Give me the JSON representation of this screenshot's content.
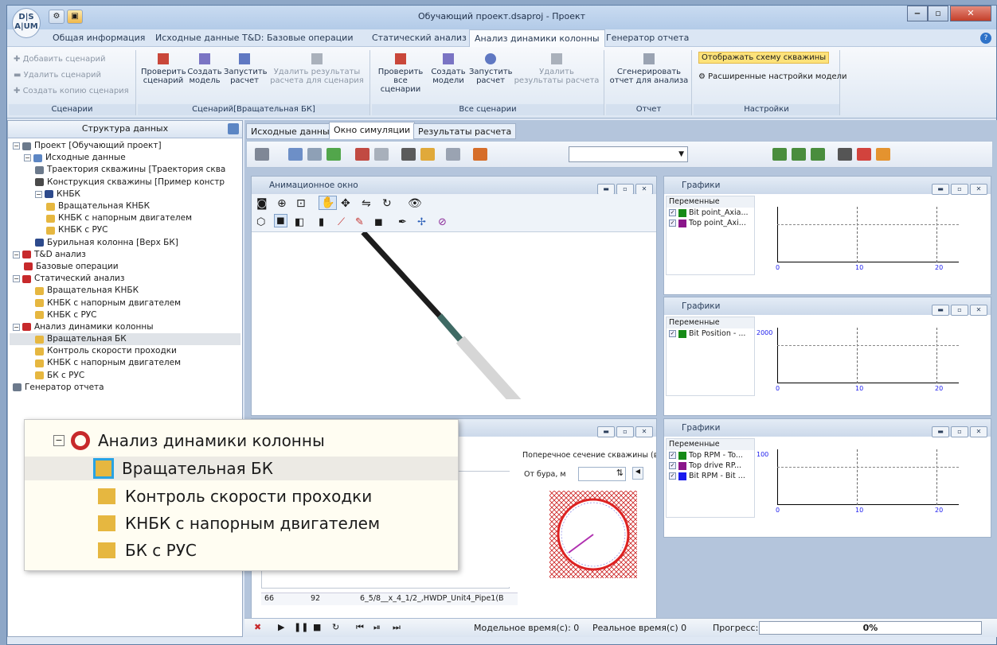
{
  "window": {
    "title": "Обучающий проект.dsaproj - Проект",
    "app_logo": "DS AUM"
  },
  "menu": [
    "Общая информация",
    "Исходные данные",
    "T&D: Базовые операции",
    "Статический анализ",
    "Анализ динамики колонны",
    "Генератор отчета"
  ],
  "ribbon": {
    "scen": {
      "add": "Добавить сценарий",
      "del": "Удалить сценарий",
      "copy": "Создать копию сценария",
      "title": "Сценарии"
    },
    "rot": {
      "check": "Проверить сценарий",
      "create": "Создать модель",
      "run": "Запустить расчет",
      "delres": "Удалить результаты расчета для сценария",
      "title": "Сценарий[Вращательная БК]"
    },
    "all": {
      "check": "Проверить все сценарии",
      "create": "Создать модели",
      "run": "Запустить расчет",
      "delres": "Удалить результаты расчета",
      "title": "Все сценарии"
    },
    "report": {
      "gen": "Сгенерировать отчет для анализа",
      "title": "Отчет"
    },
    "settings": {
      "scheme": "Отображать схему скважины",
      "adv": "Расширенные настройки модели",
      "title": "Настройки"
    }
  },
  "left": {
    "title": "Структура данных",
    "tree": [
      {
        "t": "Проект [Обучающий проект]",
        "lvl": 0,
        "exp": "−",
        "c": "#6c7a8c"
      },
      {
        "t": "Исходные данные",
        "lvl": 1,
        "exp": "−",
        "c": "#5c86c4"
      },
      {
        "t": "Траектория скважины [Траектория сква",
        "lvl": 2,
        "c": "#6c7a8c"
      },
      {
        "t": "Конструкция скважины [Пример констр",
        "lvl": 2,
        "c": "#4a4a4a"
      },
      {
        "t": "КНБК",
        "lvl": 2,
        "exp": "−",
        "c": "#2d4a8c"
      },
      {
        "t": "Вращательная КНБК",
        "lvl": 3,
        "c": "#e6b740"
      },
      {
        "t": "КНБК с напорным двигателем",
        "lvl": 3,
        "c": "#e6b740"
      },
      {
        "t": "КНБК с РУС",
        "lvl": 3,
        "c": "#e6b740"
      },
      {
        "t": "Бурильная колонна [Верх БК]",
        "lvl": 2,
        "c": "#2d4a8c"
      },
      {
        "t": "T&D анализ",
        "lvl": 0,
        "exp": "−",
        "c": "#c7292b"
      },
      {
        "t": "Базовые операции",
        "lvl": 1,
        "c": "#c7292b"
      },
      {
        "t": "Статический анализ",
        "lvl": 0,
        "exp": "−",
        "c": "#c7292b"
      },
      {
        "t": "Вращательная КНБК",
        "lvl": 2,
        "c": "#e6b740"
      },
      {
        "t": "КНБК с напорным двигателем",
        "lvl": 2,
        "c": "#e6b740"
      },
      {
        "t": "КНБК с РУС",
        "lvl": 2,
        "c": "#e6b740"
      },
      {
        "t": "Анализ динамики колонны",
        "lvl": 0,
        "exp": "−",
        "c": "#c7292b"
      },
      {
        "t": "Вращательная БК",
        "lvl": 2,
        "c": "#e6b740",
        "sel": true
      },
      {
        "t": "Контроль скорости проходки",
        "lvl": 2,
        "c": "#e6b740"
      },
      {
        "t": "КНБК с напорным двигателем",
        "lvl": 2,
        "c": "#e6b740"
      },
      {
        "t": "БК с РУС",
        "lvl": 2,
        "c": "#e6b740"
      },
      {
        "t": "Генератор отчета",
        "lvl": 0,
        "c": "#6c7a8c"
      }
    ]
  },
  "tabs": [
    "Исходные данные",
    "Окно симуляции",
    "Результаты расчета"
  ],
  "anim": {
    "title": "Анимационное окно"
  },
  "graphs": [
    {
      "title": "Графики",
      "vars_header": "Переменные",
      "vars": [
        {
          "n": "Bit point_Axia...",
          "c": "#168a16"
        },
        {
          "n": "Top point_Axi...",
          "c": "#8a168a"
        }
      ],
      "ticks": [
        "0",
        "10",
        "20"
      ],
      "yticks": []
    },
    {
      "title": "Графики",
      "vars_header": "Переменные",
      "vars": [
        {
          "n": "Bit Position - ...",
          "c": "#168a16"
        }
      ],
      "ticks": [
        "0",
        "10",
        "20"
      ],
      "yticks": [
        "2000"
      ]
    },
    {
      "title": "Графики",
      "vars_header": "Переменные",
      "vars": [
        {
          "n": "Top RPM - To...",
          "c": "#168a16"
        },
        {
          "n": "Top drive RP...",
          "c": "#8a168a"
        },
        {
          "n": "Bit RPM - Bit ...",
          "c": "#1a1aee"
        }
      ],
      "ticks": [
        "0",
        "10",
        "20"
      ],
      "yticks": [
        "100"
      ]
    }
  ],
  "cross": {
    "title": "Поперечное сечение скважины (вi",
    "from_label": "От бура, м"
  },
  "bottom_row": {
    "c1": "66",
    "c2": "92",
    "c3": "6_5/8__x_4_1/2_,HWDP_Unit4_Pipe1(B"
  },
  "status": {
    "model_time": "Модельное время(с): 0",
    "real_time": "Реальное время(с) 0",
    "progress_label": "Прогресс:",
    "progress": "0%"
  },
  "zoom": {
    "root": "Анализ динамики колонны",
    "items": [
      "Вращательная БК",
      "Контроль скорости проходки",
      "КНБК с напорным двигателем",
      "БК с РУС"
    ]
  }
}
